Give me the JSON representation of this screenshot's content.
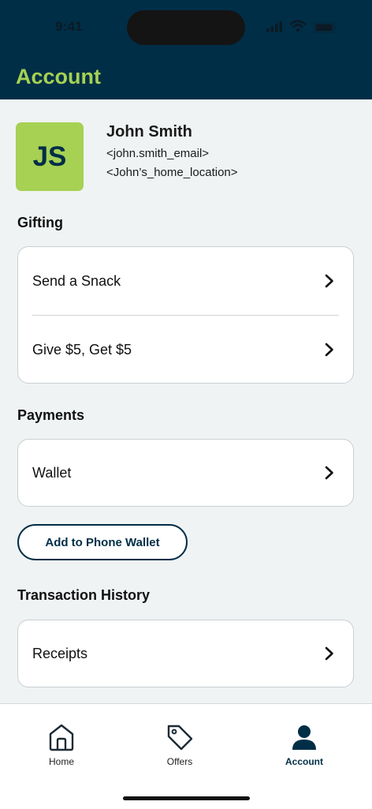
{
  "status_bar": {
    "time": "9:41"
  },
  "header": {
    "title": "Account",
    "accent": "#a6d153",
    "background": "#002e47"
  },
  "profile": {
    "initials": "JS",
    "name": "John Smith",
    "email": "<john.smith_email>",
    "location": "<John’s_home_location>"
  },
  "gifting": {
    "title": "Gifting",
    "items": [
      {
        "label": "Send a Snack",
        "icon": "chevron-right-icon"
      },
      {
        "label": "Give $5, Get $5",
        "icon": "chevron-right-icon"
      }
    ]
  },
  "payments": {
    "title": "Payments",
    "items": [
      {
        "label": "Wallet",
        "icon": "chevron-right-icon"
      }
    ],
    "add_button": "Add to Phone Wallet"
  },
  "transactions": {
    "title": "Transaction History",
    "items": [
      {
        "label": "Receipts",
        "icon": "chevron-right-icon"
      }
    ]
  },
  "tabbar": {
    "tabs": [
      {
        "label": "Home",
        "icon": "home-icon"
      },
      {
        "label": "Offers",
        "icon": "tag-icon"
      },
      {
        "label": "Account",
        "icon": "person-icon",
        "active": true
      }
    ]
  }
}
